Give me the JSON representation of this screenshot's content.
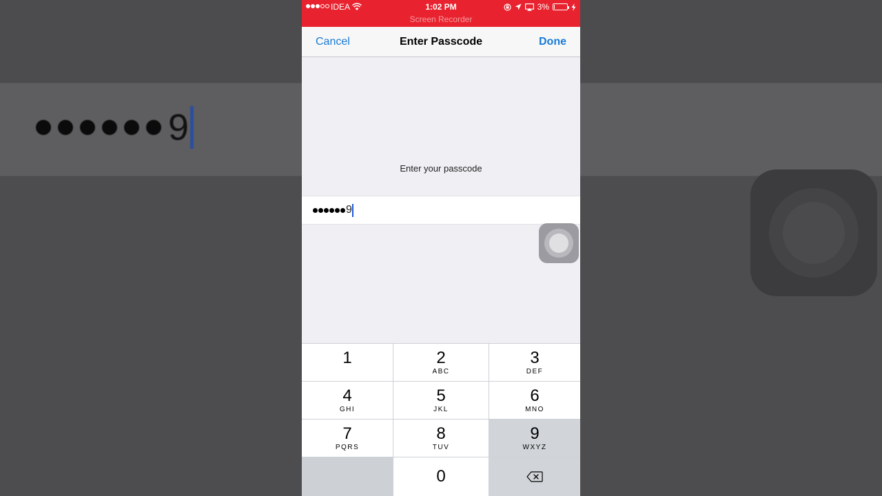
{
  "status_bar": {
    "carrier": "IDEA",
    "time": "1:02 PM",
    "battery_percent": "3%",
    "battery_level": 0.03,
    "recording_label": "Screen Recorder",
    "accent_color": "#e8232f"
  },
  "nav": {
    "cancel_label": "Cancel",
    "title": "Enter Passcode",
    "done_label": "Done"
  },
  "passcode": {
    "prompt": "Enter your passcode",
    "masked_count": 6,
    "last_digit": "9"
  },
  "keypad": {
    "keys": [
      {
        "num": "1",
        "letters": ""
      },
      {
        "num": "2",
        "letters": "ABC"
      },
      {
        "num": "3",
        "letters": "DEF"
      },
      {
        "num": "4",
        "letters": "GHI"
      },
      {
        "num": "5",
        "letters": "JKL"
      },
      {
        "num": "6",
        "letters": "MNO"
      },
      {
        "num": "7",
        "letters": "PQRS"
      },
      {
        "num": "8",
        "letters": "TUV"
      },
      {
        "num": "9",
        "letters": "WXYZ"
      },
      {
        "num": "0",
        "letters": ""
      }
    ],
    "delete_icon": "backspace-icon"
  },
  "background_preview": {
    "last_digit": "9"
  }
}
